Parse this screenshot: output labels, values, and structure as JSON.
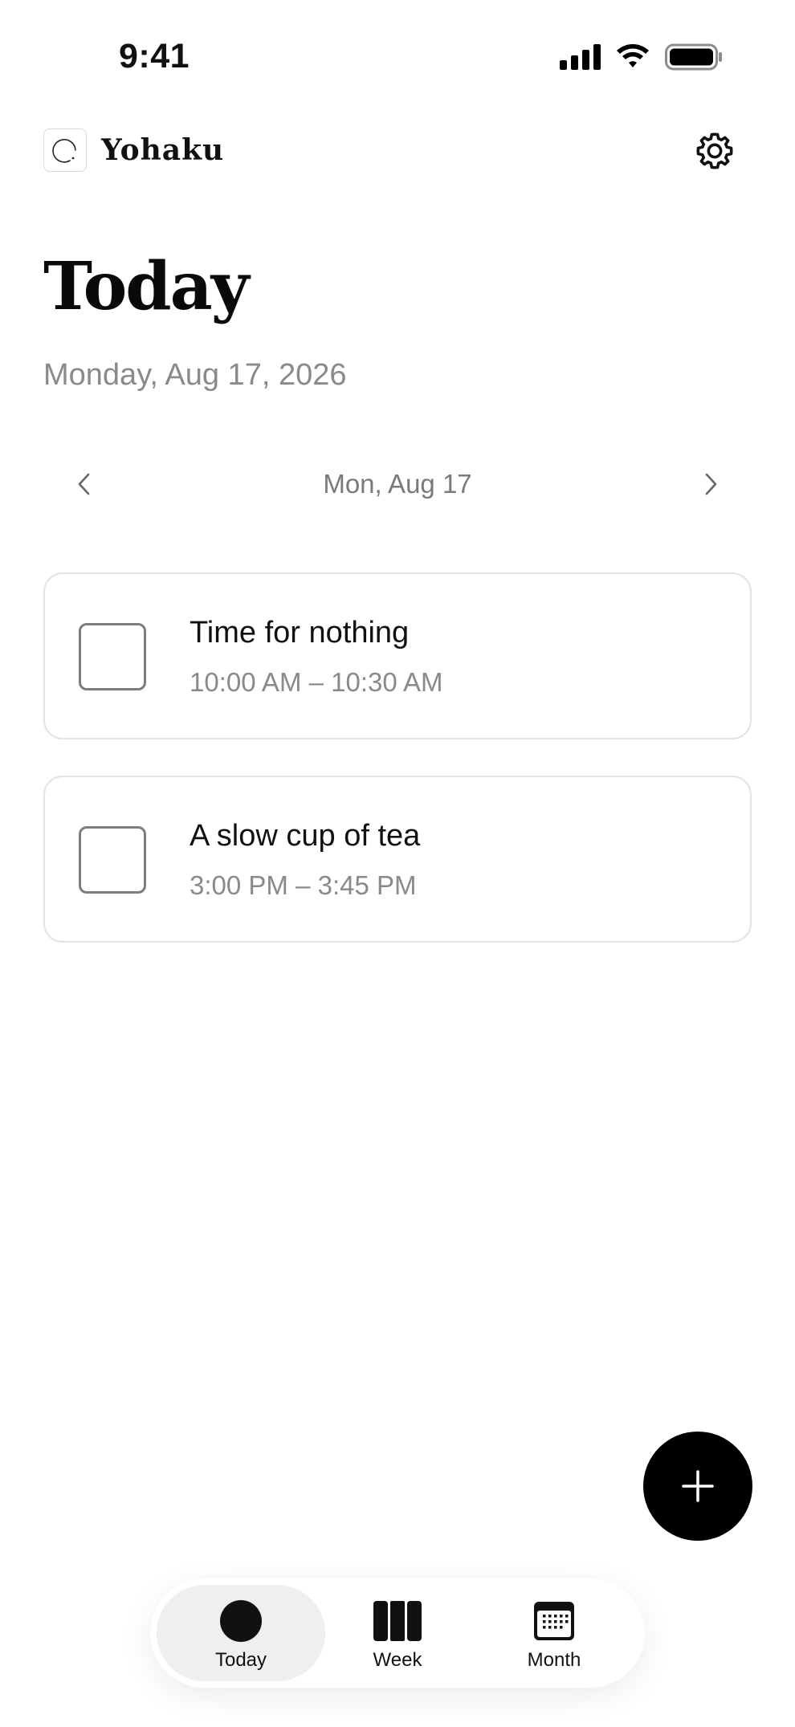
{
  "status_bar": {
    "time": "9:41"
  },
  "header": {
    "app_name": "Yohaku",
    "logo_icon": "enso-circle-icon",
    "settings_icon": "gear-icon"
  },
  "page": {
    "title": "Today",
    "subtitle": "Monday, Aug 17, 2026"
  },
  "date_nav": {
    "label": "Mon, Aug 17",
    "prev_icon": "chevron-left-icon",
    "next_icon": "chevron-right-icon"
  },
  "tasks": [
    {
      "title": "Time for nothing",
      "time": "10:00 AM – 10:30 AM",
      "done": false
    },
    {
      "title": "A slow cup of tea",
      "time": "3:00 PM – 3:45 PM",
      "done": false
    }
  ],
  "fab": {
    "icon": "plus-icon"
  },
  "tab_bar": {
    "tabs": [
      {
        "label": "Today",
        "icon": "circle-icon",
        "active": true
      },
      {
        "label": "Week",
        "icon": "columns-icon",
        "active": false
      },
      {
        "label": "Month",
        "icon": "calendar-grid-icon",
        "active": false
      }
    ]
  },
  "colors": {
    "accent": "#000000",
    "muted_text": "#8a8a8a",
    "card_border": "#e3e3e3",
    "active_tab_bg": "#efefef"
  }
}
